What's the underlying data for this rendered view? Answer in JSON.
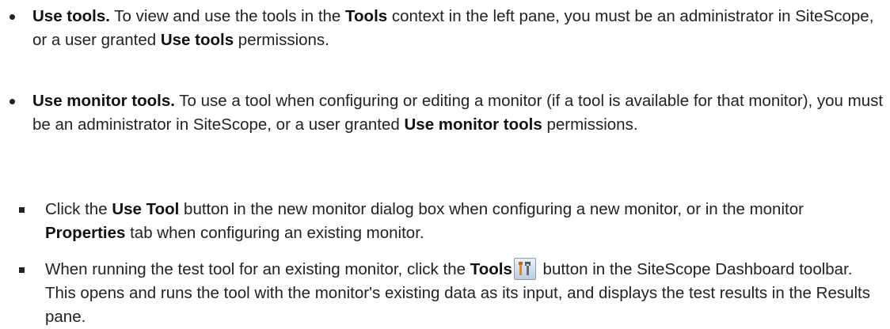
{
  "items": [
    {
      "title": "Use tools.",
      "t1": " To view and use the tools in the ",
      "b1": "Tools",
      "t2": " context in the left pane, you must be an administrator in SiteScope, or a user granted ",
      "b2": "Use tools",
      "t3": " permissions."
    },
    {
      "title": "Use monitor tools.",
      "t1": " To use a tool when configuring or editing a monitor (if a tool is available for that monitor), you must be an administrator in SiteScope, or a user granted ",
      "b1": "Use monitor tools",
      "t2": " permissions."
    },
    {
      "t1": "Click the ",
      "b1": "Use Tool",
      "t2": " button in the new monitor dialog box when configuring a new monitor, or in the monitor ",
      "b2": "Properties",
      "t3": " tab when configuring an existing monitor."
    },
    {
      "t1": "When running the test tool for an existing monitor, click the ",
      "b1": "Tools",
      "t2": " button in the SiteScope Dashboard toolbar. This opens and runs the tool with the monitor's existing data as its input, and displays the test results in the Results pane.",
      "icon": "tools-icon"
    }
  ]
}
